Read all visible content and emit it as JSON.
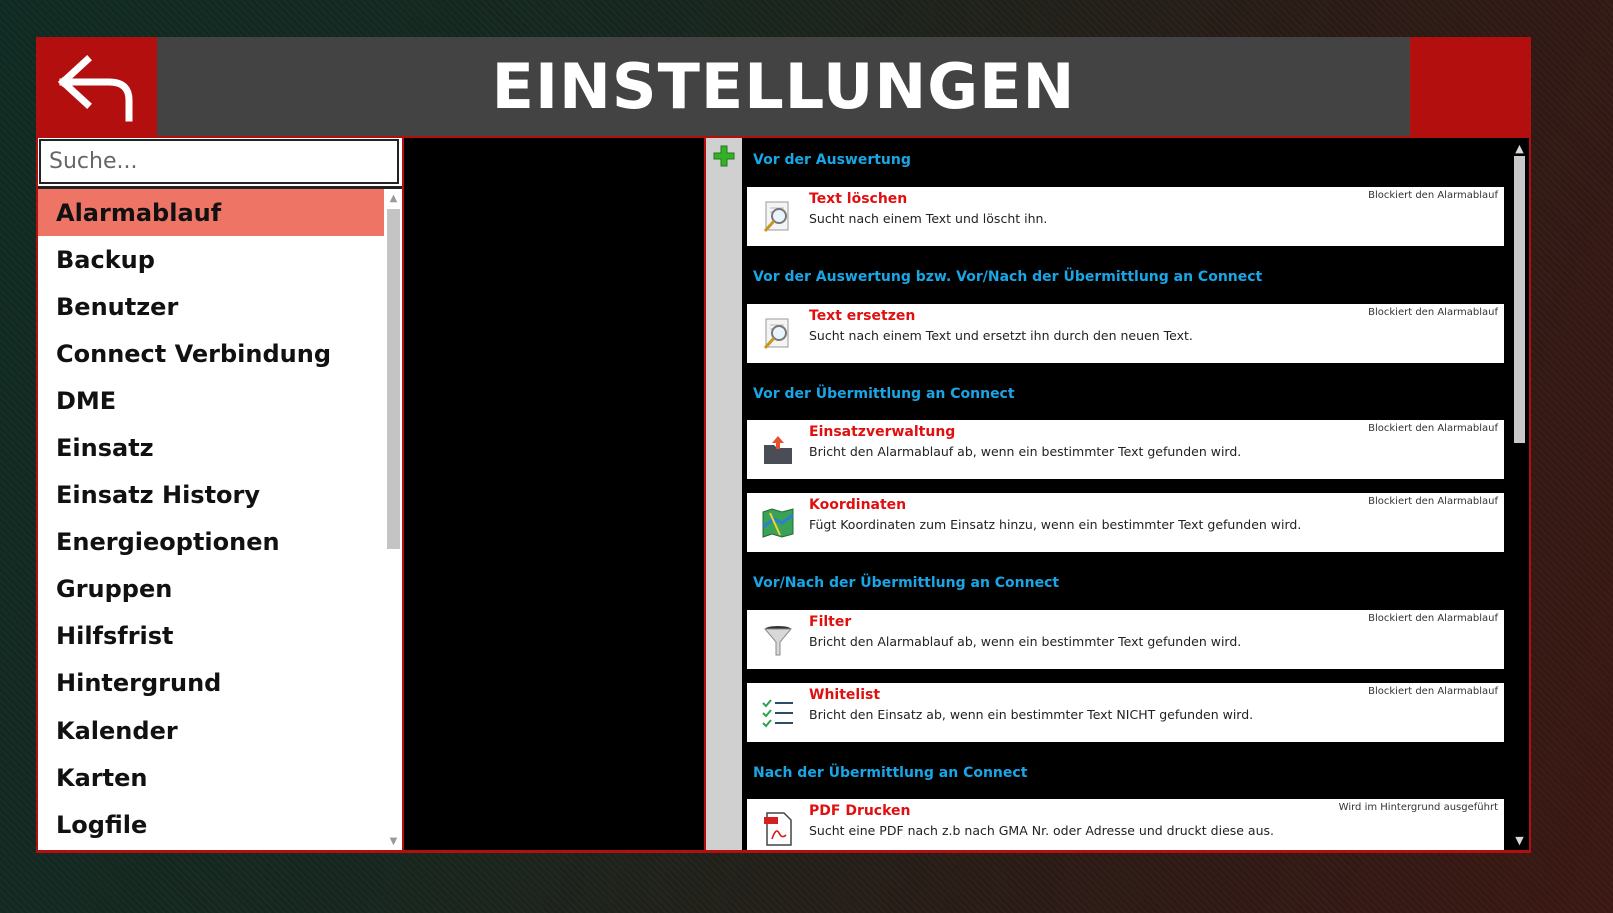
{
  "header": {
    "title": "EINSTELLUNGEN",
    "back_icon": "arrow-back-icon",
    "accent_color": "#b30f0f",
    "title_bg": "#434343"
  },
  "sidebar": {
    "search_placeholder": "Suche...",
    "selected_color": "#ee7466",
    "items": [
      {
        "label": "Alarmablauf",
        "selected": true
      },
      {
        "label": "Backup"
      },
      {
        "label": "Benutzer"
      },
      {
        "label": "Connect Verbindung"
      },
      {
        "label": "DME"
      },
      {
        "label": "Einsatz"
      },
      {
        "label": "Einsatz History"
      },
      {
        "label": "Energieoptionen"
      },
      {
        "label": "Gruppen"
      },
      {
        "label": "Hilfsfrist"
      },
      {
        "label": "Hintergrund"
      },
      {
        "label": "Kalender"
      },
      {
        "label": "Karten"
      },
      {
        "label": "Logfile"
      }
    ]
  },
  "content": {
    "add_icon": "plus-icon",
    "sections": [
      {
        "title": "Vor der Auswertung",
        "items": [
          {
            "title": "Text löschen",
            "description": "Sucht nach einem Text und löscht ihn.",
            "status": "Blockiert den Alarmablauf",
            "icon": "search-document-icon"
          }
        ]
      },
      {
        "title": "Vor der Auswertung bzw. Vor/Nach der Übermittlung an Connect",
        "items": [
          {
            "title": "Text ersetzen",
            "description": "Sucht nach einem Text und ersetzt ihn durch den neuen Text.",
            "status": "Blockiert den Alarmablauf",
            "icon": "search-document-icon"
          }
        ]
      },
      {
        "title": "Vor der Übermittlung an Connect",
        "items": [
          {
            "title": "Einsatzverwaltung",
            "description": "Bricht den Alarmablauf ab, wenn ein bestimmter Text gefunden wird.",
            "status": "Blockiert den Alarmablauf",
            "icon": "folder-upload-icon"
          },
          {
            "title": "Koordinaten",
            "description": "Fügt Koordinaten zum Einsatz hinzu, wenn ein bestimmter Text gefunden wird.",
            "status": "Blockiert den Alarmablauf",
            "icon": "map-icon"
          }
        ]
      },
      {
        "title": "Vor/Nach der Übermittlung an Connect",
        "items": [
          {
            "title": "Filter",
            "description": "Bricht den Alarmablauf ab, wenn ein bestimmter Text gefunden wird.",
            "status": "Blockiert den Alarmablauf",
            "icon": "funnel-icon"
          },
          {
            "title": "Whitelist",
            "description": "Bricht den Einsatz ab, wenn ein bestimmter Text NICHT gefunden wird.",
            "status": "Blockiert den Alarmablauf",
            "icon": "checklist-icon"
          }
        ]
      },
      {
        "title": "Nach der Übermittlung an Connect",
        "items": [
          {
            "title": "PDF Drucken",
            "description": "Sucht eine PDF nach z.b nach GMA Nr. oder Adresse und druckt diese aus.",
            "status": "Wird im Hintergrund ausgeführt",
            "icon": "pdf-icon"
          }
        ]
      }
    ]
  }
}
